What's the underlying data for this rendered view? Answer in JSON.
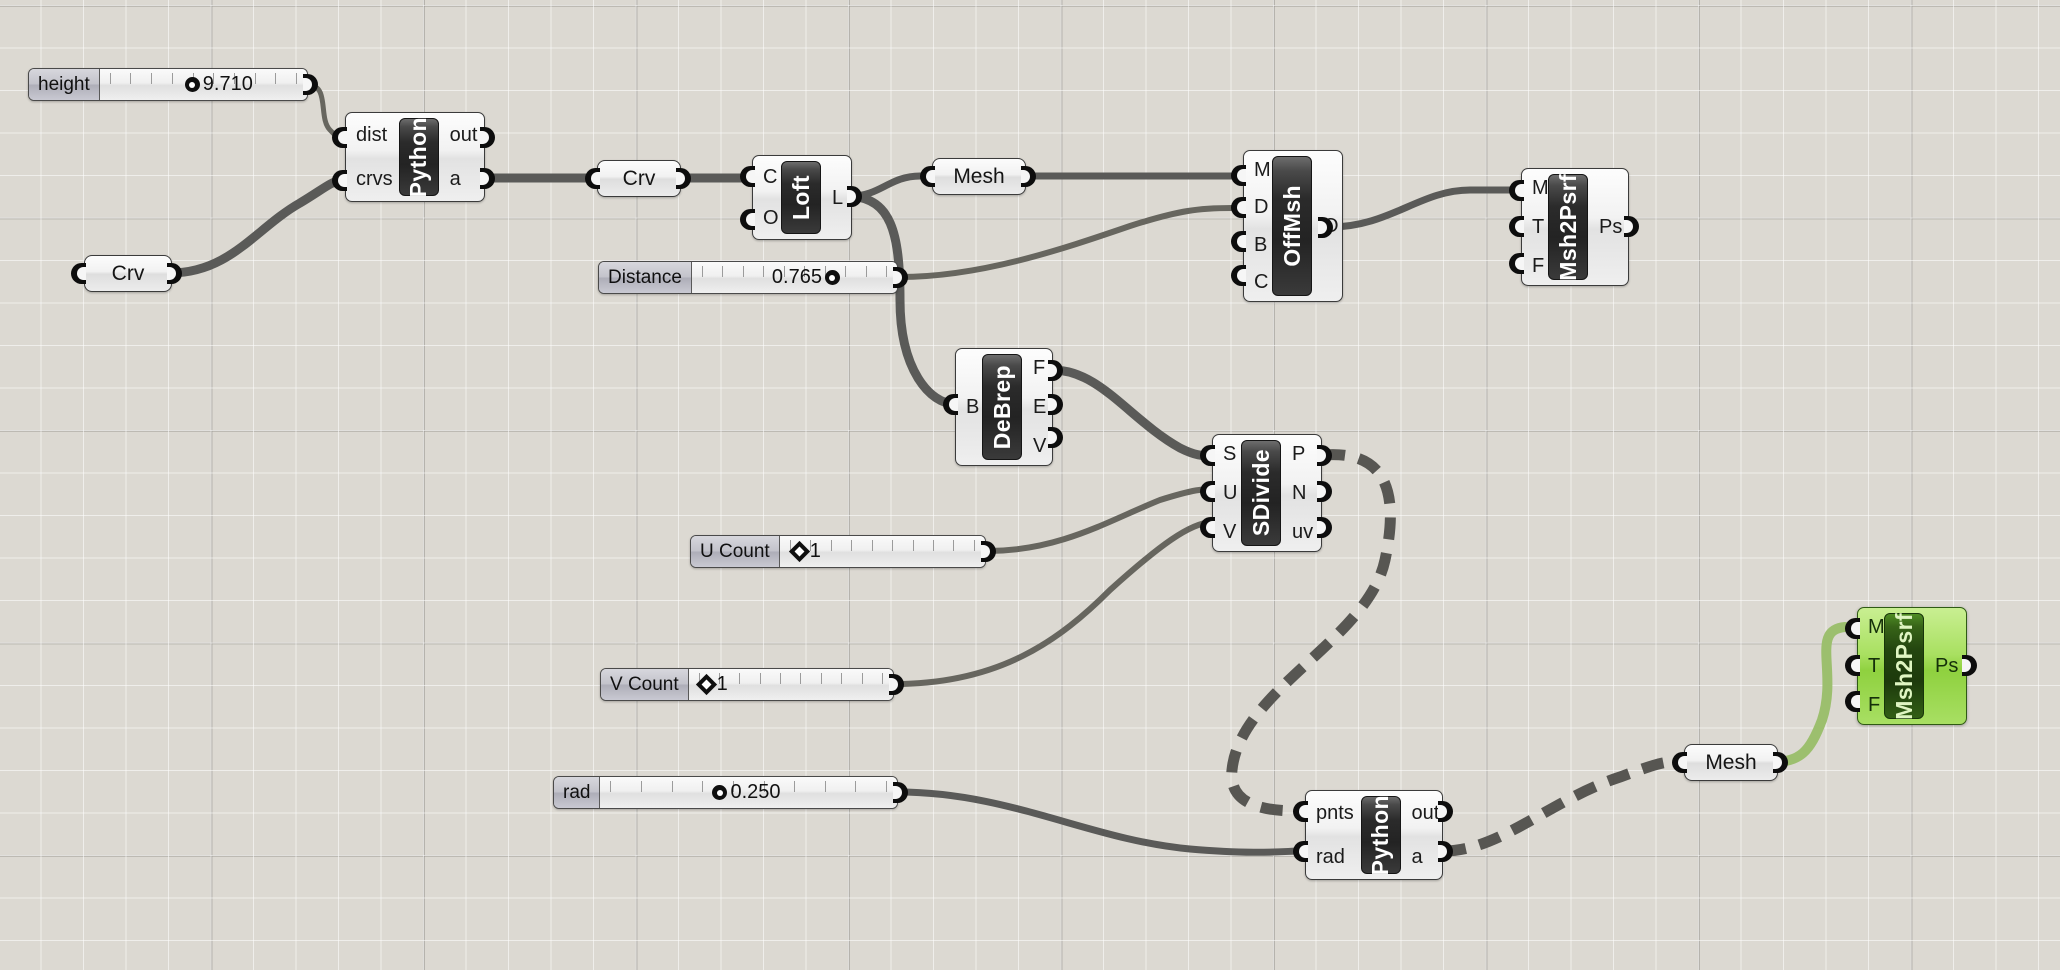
{
  "app": {
    "name": "Grasshopper Canvas",
    "background_color": "#dcd9d2",
    "grid_color": "#96948e",
    "selection_color": "#8fd13f"
  },
  "sliders": [
    {
      "name": "height",
      "value": "9.710",
      "grip": "round",
      "fill": 0.5
    },
    {
      "name": "Distance",
      "value": "0.765",
      "grip": "round",
      "fill": 0.56
    },
    {
      "name": "U Count",
      "value": "1",
      "grip": "diamond",
      "fill": 0.07
    },
    {
      "name": "V Count",
      "value": "1",
      "grip": "diamond",
      "fill": 0.06
    },
    {
      "name": "rad",
      "value": "0.250",
      "grip": "round",
      "fill": 0.42
    }
  ],
  "panels": [
    {
      "label": "Crv"
    },
    {
      "label": "Crv"
    },
    {
      "label": "Mesh"
    },
    {
      "label": "Mesh"
    }
  ],
  "components": [
    {
      "title": "Python",
      "inputs": [
        "dist",
        "crvs"
      ],
      "outputs": [
        "out",
        "a"
      ],
      "selected": false
    },
    {
      "title": "Loft",
      "inputs": [
        "C",
        "O"
      ],
      "outputs": [
        "L"
      ],
      "selected": false
    },
    {
      "title": "OffMsh",
      "inputs": [
        "M",
        "D",
        "B",
        "C"
      ],
      "outputs": [
        "O"
      ],
      "selected": false
    },
    {
      "title": "Msh2Psrf",
      "inputs": [
        "M",
        "T",
        "F"
      ],
      "outputs": [
        "Ps"
      ],
      "selected": false
    },
    {
      "title": "DeBrep",
      "inputs": [
        "B"
      ],
      "outputs": [
        "F",
        "E",
        "V"
      ],
      "selected": false
    },
    {
      "title": "SDivide",
      "inputs": [
        "S",
        "U",
        "V"
      ],
      "outputs": [
        "P",
        "N",
        "uv"
      ],
      "selected": false
    },
    {
      "title": "Python",
      "inputs": [
        "pnts",
        "rad"
      ],
      "outputs": [
        "out",
        "a"
      ],
      "selected": false
    },
    {
      "title": "Msh2Psrf",
      "inputs": [
        "M",
        "T",
        "F"
      ],
      "outputs": [
        "Ps"
      ],
      "selected": true
    }
  ],
  "wires": {
    "thick_color": "#5a5a58",
    "thin_color": "#67665f",
    "selected_color": "#9cbf6e",
    "dashed_color": "#575652"
  }
}
